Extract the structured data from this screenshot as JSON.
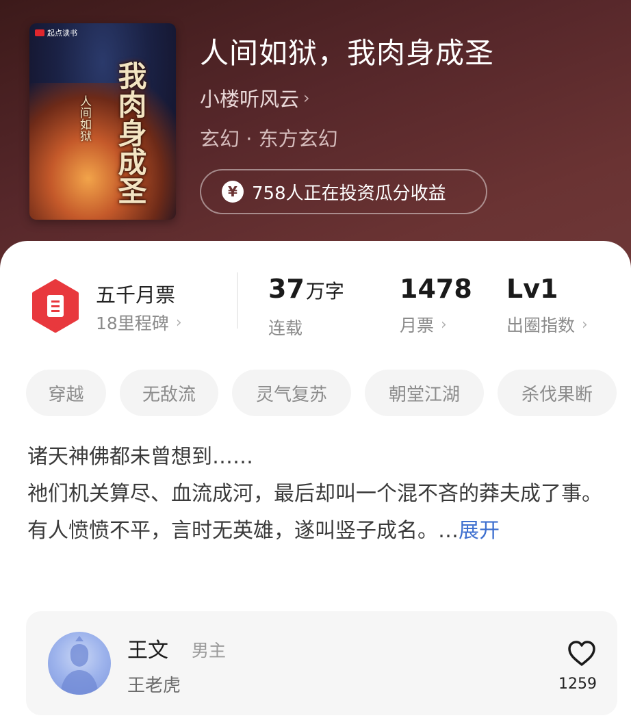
{
  "header": {
    "cover": {
      "brand": "起点读书",
      "title": "我肉身成圣",
      "subtitle": "人间如狱"
    },
    "title": "人间如狱，我肉身成圣",
    "author": "小楼听风云",
    "author_chevron": "›",
    "genre": "玄幻 · 东方玄幻",
    "invest": {
      "icon": "yen-coin-icon",
      "symbol": "¥",
      "text": "758人正在投资瓜分收益"
    }
  },
  "stats": {
    "milestone": {
      "title": "五千月票",
      "sub": "18里程碑",
      "badge_color": "#e8383d"
    },
    "words": {
      "value": "37",
      "unit": "万字",
      "label": "连载"
    },
    "votes": {
      "value": "1478",
      "label": "月票"
    },
    "circle": {
      "value": "Lv1",
      "label": "出圈指数"
    }
  },
  "tags": [
    "穿越",
    "无敌流",
    "灵气复苏",
    "朝堂江湖",
    "杀伐果断"
  ],
  "synopsis": {
    "line1": "诸天神佛都未曾想到……",
    "line2": "祂们机关算尽、血流成河，最后却叫一个混不吝的莽夫成了事。",
    "line3": "有人愤愤不平，言时无英雄，遂叫竖子成名。…",
    "expand": "展开"
  },
  "character": {
    "name": "王文",
    "role": "男主",
    "alias": "王老虎",
    "likes": "1259",
    "accent": "#3d6fcf"
  }
}
